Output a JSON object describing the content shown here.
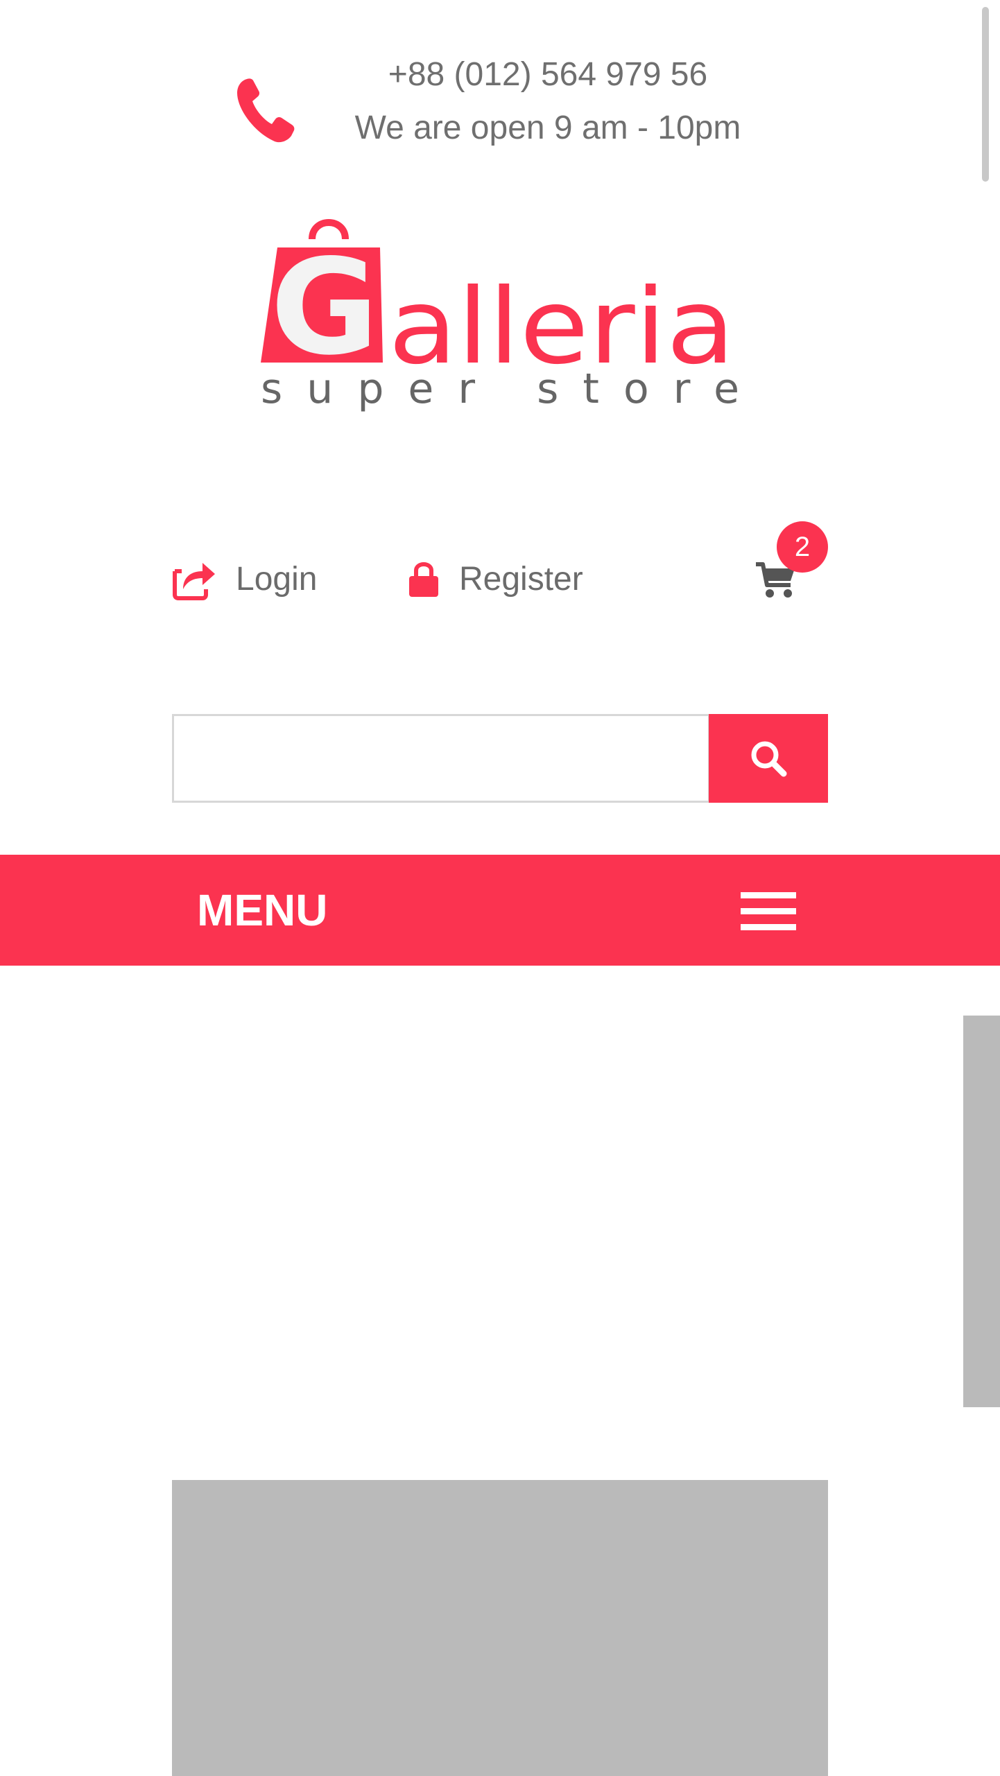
{
  "contact": {
    "icon": "phone-icon",
    "phone": "+88 (012) 564 979 56",
    "hours": "We are open 9 am - 10pm"
  },
  "brand": {
    "logo_text": "Galleria",
    "tagline": "super store",
    "accent_color": "#fb3350",
    "tagline_color": "#666666"
  },
  "account": {
    "login_label": "Login",
    "login_icon": "share-arrow-icon",
    "register_label": "Register",
    "register_icon": "lock-icon"
  },
  "cart": {
    "icon": "cart-icon",
    "count": "2"
  },
  "search": {
    "placeholder": "",
    "value": "",
    "button_icon": "search-icon"
  },
  "menu": {
    "label": "MENU",
    "toggle_icon": "hamburger-icon",
    "background": "#fb3350"
  }
}
